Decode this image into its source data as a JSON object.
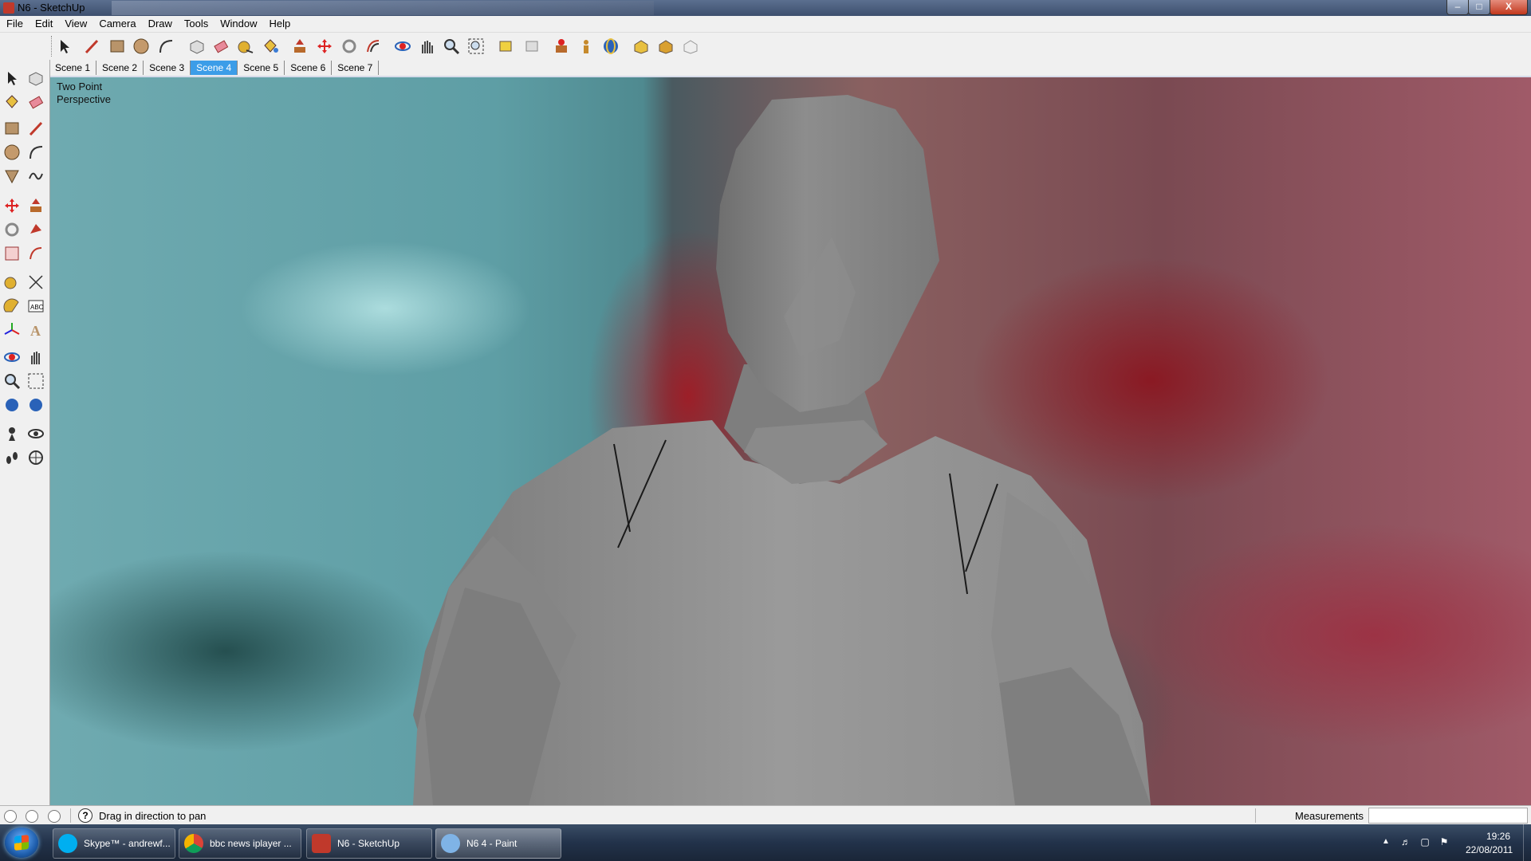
{
  "window": {
    "title": "N6 - SketchUp"
  },
  "menu": [
    "File",
    "Edit",
    "View",
    "Camera",
    "Draw",
    "Tools",
    "Window",
    "Help"
  ],
  "toolbar_icons": [
    "select-icon",
    "line-icon",
    "rectangle-icon",
    "circle-icon",
    "arc-icon",
    "make-component-icon",
    "eraser-icon",
    "tape-measure-icon",
    "paint-bucket-icon",
    "push-pull-icon",
    "move-icon",
    "rotate-icon",
    "offset-icon",
    "orbit-icon",
    "pan-icon",
    "zoom-icon",
    "zoom-extents-icon",
    "previous-view-icon",
    "next-view-icon",
    "position-camera-icon",
    "walk-icon",
    "look-around-icon",
    "get-models-icon",
    "share-model-icon",
    "share-component-icon"
  ],
  "scenes": [
    "Scene 1",
    "Scene 2",
    "Scene 3",
    "Scene 4",
    "Scene 5",
    "Scene 6",
    "Scene 7"
  ],
  "active_scene": "Scene 4",
  "viewport": {
    "label_line1": "Two Point",
    "label_line2": "Perspective"
  },
  "status": {
    "help_glyph": "?",
    "hint": "Drag in direction to pan",
    "measurements_label": "Measurements",
    "measurements_value": ""
  },
  "taskbar": {
    "tasks": [
      {
        "label": "Skype™ - andrewf...",
        "icon": "skype-icon",
        "color": "#00aff0"
      },
      {
        "label": "bbc news iplayer ...",
        "icon": "chrome-icon",
        "color": "#e8b600"
      },
      {
        "label": "N6 - SketchUp",
        "icon": "sketchup-icon",
        "color": "#c0392b"
      },
      {
        "label": "N6 4 - Paint",
        "icon": "paint-icon",
        "color": "#7fb3e6"
      }
    ],
    "clock_time": "19:26",
    "clock_date": "22/08/2011"
  }
}
